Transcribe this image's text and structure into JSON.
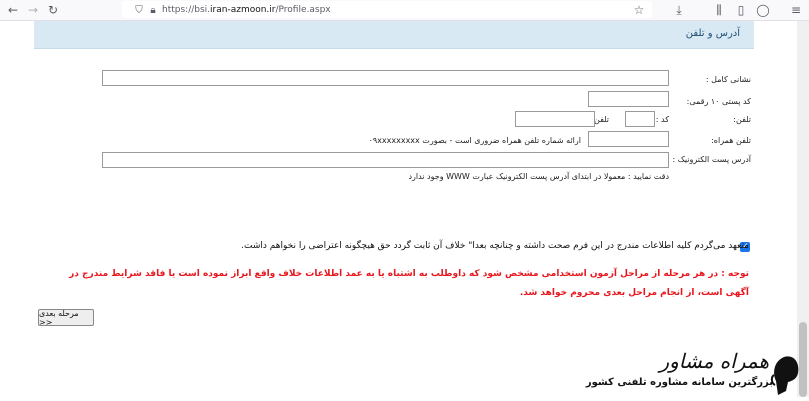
{
  "browser": {
    "url_prefix": "https://bsi.",
    "url_domain": "iran-azmoon.ir",
    "url_path": "/Profile.aspx"
  },
  "section": {
    "title": "آدرس و تلفن"
  },
  "form": {
    "full_address_label": "نشانی کامل :",
    "postal_code_label": "کد پستی ۱۰ رقمی:",
    "phone_label": "تلفن:",
    "area_code_label": "کد :",
    "phone_inner_label": "تلفن :",
    "mobile_label": "تلفن همراه:",
    "mobile_hint": "ارائه شماره تلفن همراه ضروری است - بصورت ۰۹xxxxxxxxx",
    "email_label": "آدرس پست الکترونیک :",
    "email_hint": "دقت نمایید : معمولا در ابتدای آدرس پست الکترونیک عبارت WWW وجود ندارد"
  },
  "agreement": {
    "checked": true,
    "text": "متعهد می‌گردم کلیه اطلاعات مندرج در این فرم صحت داشته و چنانچه بعدا\" خلاف آن ثابت گردد حق هیچگونه اعتراضی را نخواهم داشت."
  },
  "warning": "توجه : در هر مرحله از مراحل آزمون استخدامی مشخص شود که داوطلب به اشتباه یا به عمد اطلاعات خلاف واقع ابراز نموده است یا فاقد شرایط مندرج در آگهی است، از انجام مراحل بعدی محروم خواهد شد.",
  "next_button": "مرحله بعدی >>",
  "logo": {
    "title": "همراه مشاور",
    "subtitle": "بزرگترین سامانه مشاوره تلفنی کشور"
  },
  "colors": {
    "section_bar": "#d8e9f3",
    "warning": "#e8161d",
    "checkbox": "#1a73e8"
  }
}
